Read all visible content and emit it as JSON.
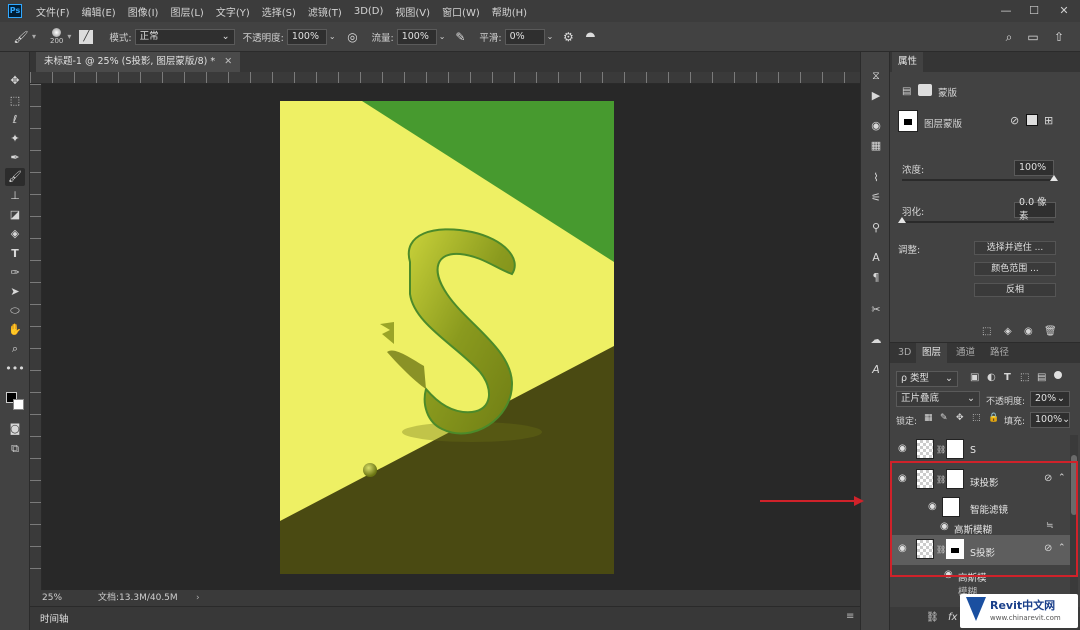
{
  "app": {
    "logo": "Ps"
  },
  "menu": [
    "文件(F)",
    "编辑(E)",
    "图像(I)",
    "图层(L)",
    "文字(Y)",
    "选择(S)",
    "滤镜(T)",
    "3D(D)",
    "视图(V)",
    "窗口(W)",
    "帮助(H)"
  ],
  "window_controls": {
    "minimize": "—",
    "maximize": "☐",
    "close": "✕"
  },
  "options": {
    "brush_size": "200",
    "mode_label": "模式:",
    "mode_value": "正常",
    "opacity_label": "不透明度:",
    "opacity_value": "100%",
    "flow_label": "流量:",
    "flow_value": "100%",
    "smooth_label": "平滑:",
    "smooth_value": "0%"
  },
  "document": {
    "tab_title": "未标题-1 @ 25% (S投影, 图层蒙版/8) *",
    "zoom": "25%",
    "doc_size": "文档:13.3M/40.5M",
    "canvas_colors": {
      "light": "#eef064",
      "mid": "#e8ec5a",
      "dark_green": "#479a2f",
      "shadow": "#4a4a12"
    }
  },
  "timeline_label": "时间轴",
  "properties": {
    "tab": "属性",
    "mask_type": "蒙版",
    "mask_name": "图层蒙版",
    "density_label": "浓度:",
    "density_value": "100%",
    "feather_label": "羽化:",
    "feather_value": "0.0 像素",
    "adjust_label": "调整:",
    "select_mask_button": "选择并遮住 ...",
    "color_range_button": "颜色范围 ...",
    "invert_button": "反相"
  },
  "layers_panel": {
    "tabs": [
      "3D",
      "图层",
      "通道",
      "路径"
    ],
    "active_tab": "图层",
    "filter_kind": "ρ 类型",
    "blend_mode": "正片叠底",
    "opacity_label": "不透明度:",
    "opacity_value": "20%",
    "lock_label": "锁定:",
    "fill_label": "填充:",
    "fill_value": "100%",
    "layers": [
      {
        "name": "S"
      },
      {
        "name": "球投影"
      },
      {
        "name": "智能滤镜"
      },
      {
        "name": "高斯模糊"
      },
      {
        "name": "S投影"
      },
      {
        "name": "高斯模"
      },
      {
        "name": "模糊"
      }
    ]
  },
  "watermark": {
    "brand": "Revit中文网",
    "url": "www.chinarevit.com"
  }
}
